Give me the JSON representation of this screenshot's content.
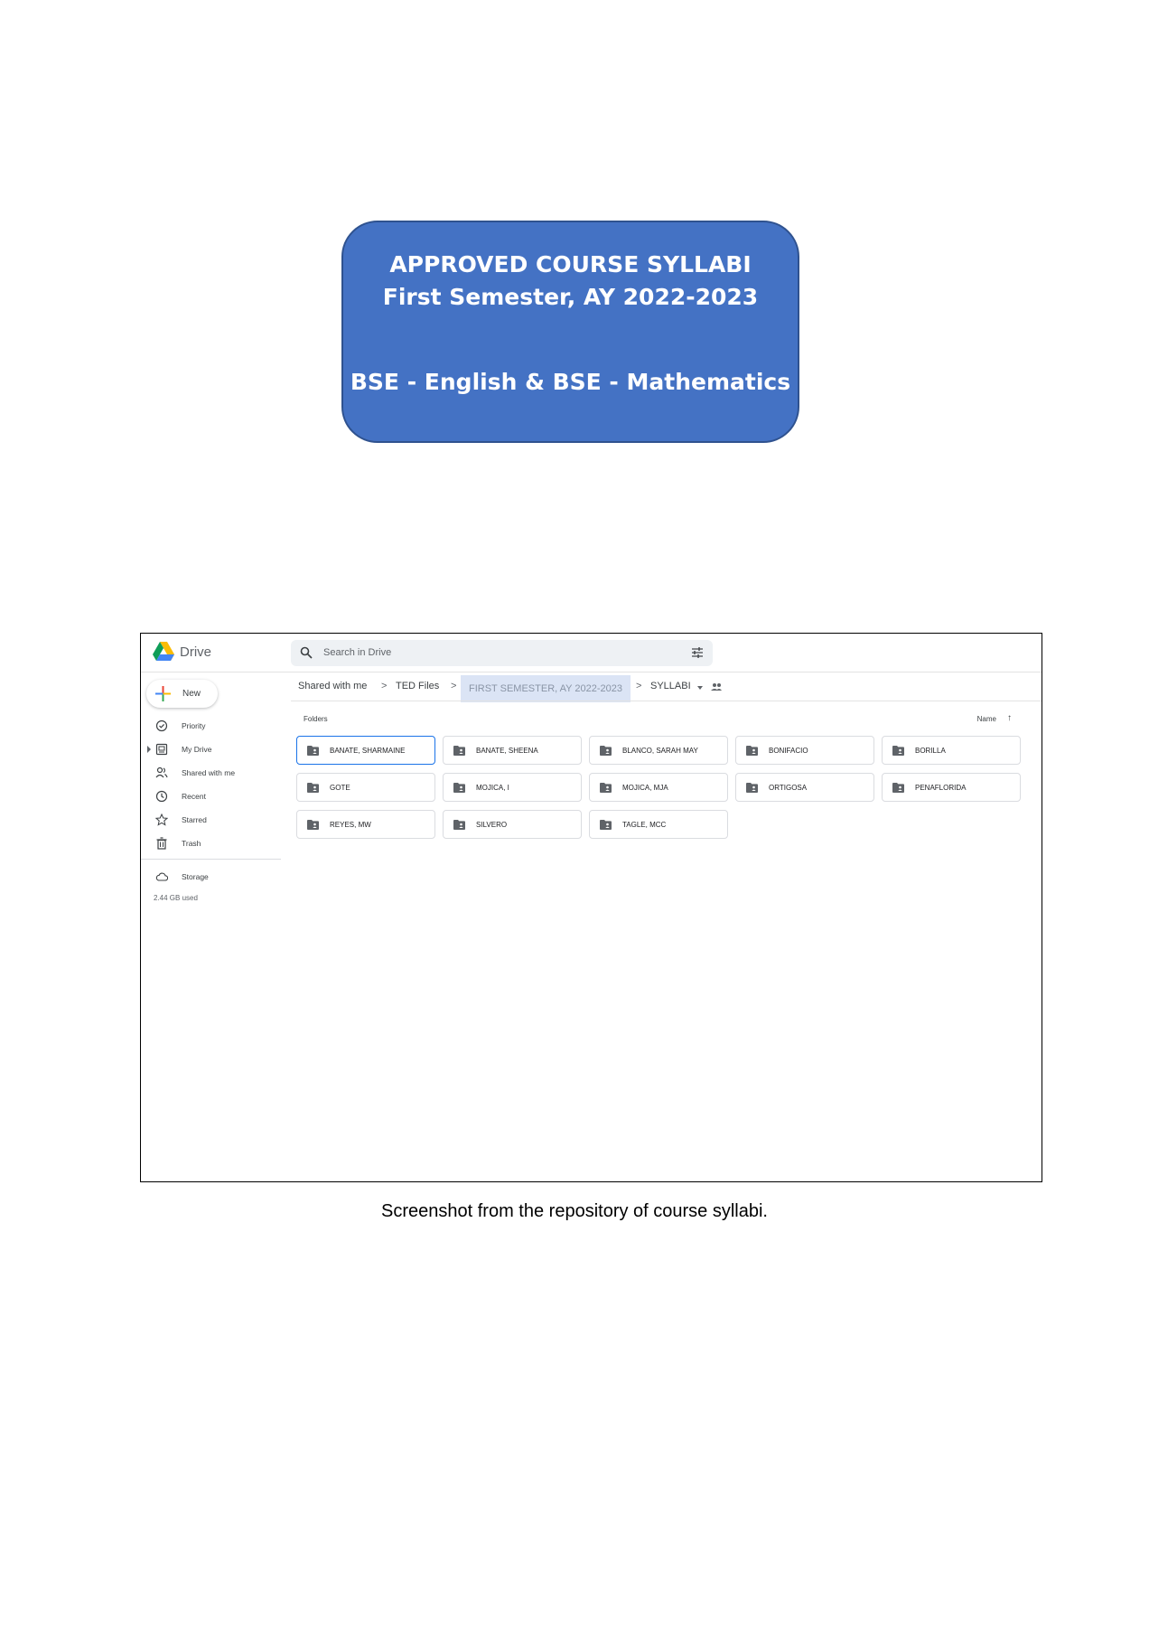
{
  "header_box": {
    "line1": "APPROVED COURSE SYLLABI",
    "line2": "First Semester, AY 2022-2023",
    "line3": "BSE - English & BSE - Mathematics"
  },
  "drive": {
    "app_name": "Drive",
    "search_placeholder": "Search in Drive",
    "new_label": "New",
    "sidebar": [
      {
        "label": "Priority",
        "icon": "priority-icon"
      },
      {
        "label": "My Drive",
        "icon": "my-drive-icon"
      },
      {
        "label": "Shared with me",
        "icon": "shared-with-me-icon"
      },
      {
        "label": "Recent",
        "icon": "clock-icon"
      },
      {
        "label": "Starred",
        "icon": "star-icon"
      },
      {
        "label": "Trash",
        "icon": "trash-icon"
      },
      {
        "label": "Storage",
        "icon": "cloud-icon"
      }
    ],
    "storage_used": "2.44 GB used",
    "breadcrumb": [
      "Shared with me",
      "TED Files",
      "FIRST SEMESTER, AY 2022-2023",
      "SYLLABI"
    ],
    "folders_label": "Folders",
    "sort_label": "Name",
    "folders": [
      "BANATE, SHARMAINE",
      "BANATE, SHEENA",
      "BLANCO, SARAH MAY",
      "BONIFACIO",
      "BORILLA",
      "GOTE",
      "MOJICA, I",
      "MOJICA, MJA",
      "ORTIGOSA",
      "PENAFLORIDA",
      "REYES, MW",
      "SILVERO",
      "TAGLE, MCC"
    ]
  },
  "caption": "Screenshot from the repository of course syllabi.",
  "colors": {
    "box_fill": "#4472c4",
    "box_border": "#2f528f",
    "selected_crumb": "#dbe4f5",
    "active_folder_border": "#1a73e8"
  }
}
